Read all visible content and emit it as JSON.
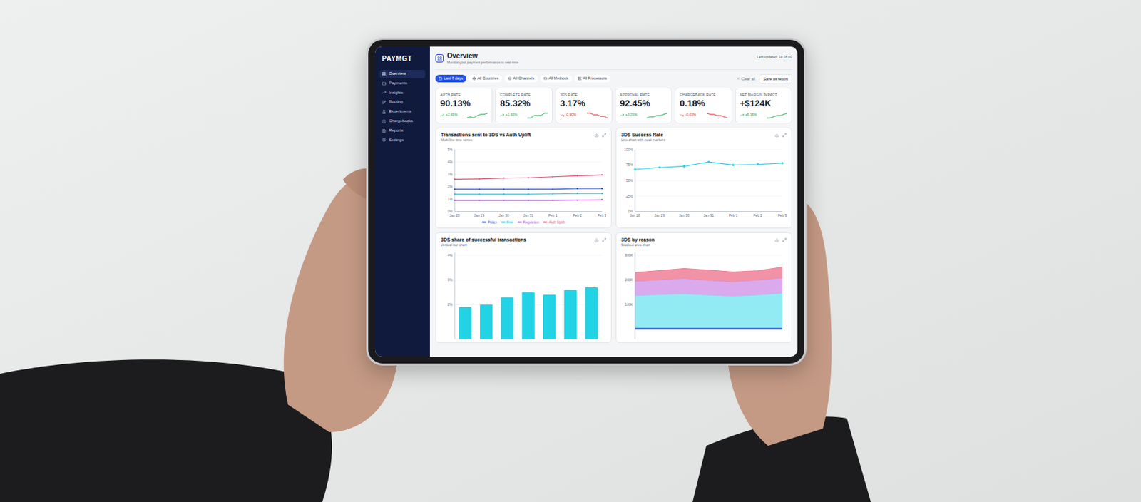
{
  "sidebar": {
    "logo": "PAYMGT",
    "items": [
      {
        "label": "Overview",
        "selected": true
      },
      {
        "label": "Payments",
        "selected": false
      },
      {
        "label": "Insights",
        "selected": false
      },
      {
        "label": "Routing",
        "selected": false
      },
      {
        "label": "Experiments",
        "selected": false
      },
      {
        "label": "Chargebacks",
        "selected": false
      },
      {
        "label": "Reports",
        "selected": false
      },
      {
        "label": "Settings",
        "selected": false
      }
    ]
  },
  "header": {
    "title": "Overview",
    "subtitle": "Monitor your payment performance in real-time",
    "updated": "Last updated: 14:28:00"
  },
  "filters": [
    {
      "label": "Last 7 days",
      "selected": true
    },
    {
      "label": "All Countries",
      "selected": false
    },
    {
      "label": "All Channels",
      "selected": false
    },
    {
      "label": "All Methods",
      "selected": false
    },
    {
      "label": "All Processors",
      "selected": false
    }
  ],
  "actions": {
    "clear": "Clear all",
    "save": "Save as report"
  },
  "kpis": [
    {
      "label": "AUTH RATE",
      "value": "90.13%",
      "change": "+2.49%",
      "direction": "up",
      "trend": [
        3,
        4,
        3,
        5,
        6,
        6,
        7
      ]
    },
    {
      "label": "COMPLETE RATE",
      "value": "85.32%",
      "change": "+1.60%",
      "direction": "up",
      "trend": [
        4,
        4,
        5,
        5,
        5,
        6,
        6
      ]
    },
    {
      "label": "3DS RATE",
      "value": "3.17%",
      "change": "-0.90%",
      "direction": "down",
      "trend": [
        7,
        7,
        6,
        6,
        5,
        5,
        4
      ]
    },
    {
      "label": "APPROVAL RATE",
      "value": "92.45%",
      "change": "+3.29%",
      "direction": "up",
      "trend": [
        3,
        4,
        4,
        5,
        5,
        6,
        7
      ]
    },
    {
      "label": "CHARGEBACK RATE",
      "value": "0.18%",
      "change": "-0.03%",
      "direction": "down",
      "trend": [
        7,
        6,
        6,
        5,
        5,
        4,
        3
      ]
    },
    {
      "label": "NET MARGIN IMPACT",
      "value": "+$124K",
      "change": "+6.16%",
      "direction": "up",
      "trend": [
        3,
        3,
        4,
        5,
        5,
        6,
        7
      ]
    }
  ],
  "charts": {
    "sent3ds": {
      "title": "Transactions sent to 3DS vs Auth Uplift",
      "subtitle": "Multi-line time series",
      "ticks": [
        "0%",
        "1%",
        "2%",
        "3%",
        "4%",
        "5%"
      ],
      "x": [
        "Jan 28",
        "Jan 29",
        "Jan 30",
        "Jan 31",
        "Feb 1",
        "Feb 2",
        "Feb 3"
      ],
      "series": [
        {
          "name": "Policy",
          "color": "#2a4bd7",
          "values": [
            1.8,
            1.8,
            1.8,
            1.8,
            1.8,
            1.85,
            1.85
          ]
        },
        {
          "name": "Risk",
          "color": "#22c7d6",
          "values": [
            1.4,
            1.4,
            1.4,
            1.4,
            1.42,
            1.45,
            1.45
          ]
        },
        {
          "name": "Regulation",
          "color": "#b14fd8",
          "values": [
            0.9,
            0.9,
            0.9,
            0.9,
            0.9,
            0.92,
            0.95
          ]
        },
        {
          "name": "Auth Uplift",
          "color": "#e0506e",
          "values": [
            2.6,
            2.63,
            2.7,
            2.72,
            2.8,
            2.88,
            2.95
          ]
        }
      ]
    },
    "success": {
      "title": "3DS Success Rate",
      "subtitle": "Line chart with peak markers",
      "ticks": [
        "0%",
        "25%",
        "50%",
        "75%",
        "100%"
      ],
      "x": [
        "Jan 28",
        "Jan 29",
        "Jan 30",
        "Jan 31",
        "Feb 1",
        "Feb 2",
        "Feb 3"
      ],
      "series": [
        {
          "color": "#22d3e6",
          "values": [
            68,
            71,
            73,
            80,
            75,
            76,
            78
          ]
        }
      ]
    },
    "share": {
      "title": "3DS share of successful transactions",
      "subtitle": "Vertical bar chart",
      "ticks": [
        "2%",
        "3%",
        "4%"
      ],
      "color": "#22d3e6",
      "values": [
        1.9,
        2.0,
        2.3,
        2.5,
        2.4,
        2.6,
        2.7
      ]
    },
    "reason": {
      "title": "3DS by reason",
      "subtitle": "Stacked area chart",
      "ticks": [
        "100K",
        "200K",
        "300K"
      ],
      "series": [
        {
          "color": "#2a4bd7",
          "values": [
            6,
            6,
            6,
            6,
            6,
            6,
            6
          ]
        },
        {
          "color": "#7fe8f0",
          "values": [
            130,
            134,
            138,
            132,
            128,
            133,
            140
          ]
        },
        {
          "color": "#d39bea",
          "values": [
            58,
            60,
            62,
            60,
            58,
            60,
            62
          ]
        },
        {
          "color": "#ef7f96",
          "values": [
            36,
            38,
            40,
            42,
            40,
            38,
            44
          ]
        }
      ]
    }
  }
}
